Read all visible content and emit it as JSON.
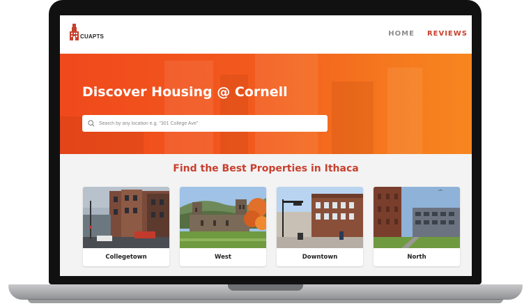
{
  "nav": {
    "logo_text": "CUAPTS",
    "items": [
      {
        "label": "HOME",
        "active": false
      },
      {
        "label": "REVIEWS",
        "active": true
      }
    ]
  },
  "hero": {
    "title": "Discover Housing @ Cornell",
    "search_placeholder": "Search by any location e.g. \"301 College Ave\""
  },
  "properties": {
    "heading": "Find the Best Properties in Ithaca",
    "cards": [
      {
        "label": "Collegetown"
      },
      {
        "label": "West"
      },
      {
        "label": "Downtown"
      },
      {
        "label": "North"
      }
    ]
  },
  "colors": {
    "accent": "#c8402e",
    "hero_start": "#f0491c",
    "hero_end": "#f7861f"
  },
  "icons": [
    "building-logo-icon",
    "search-icon"
  ]
}
